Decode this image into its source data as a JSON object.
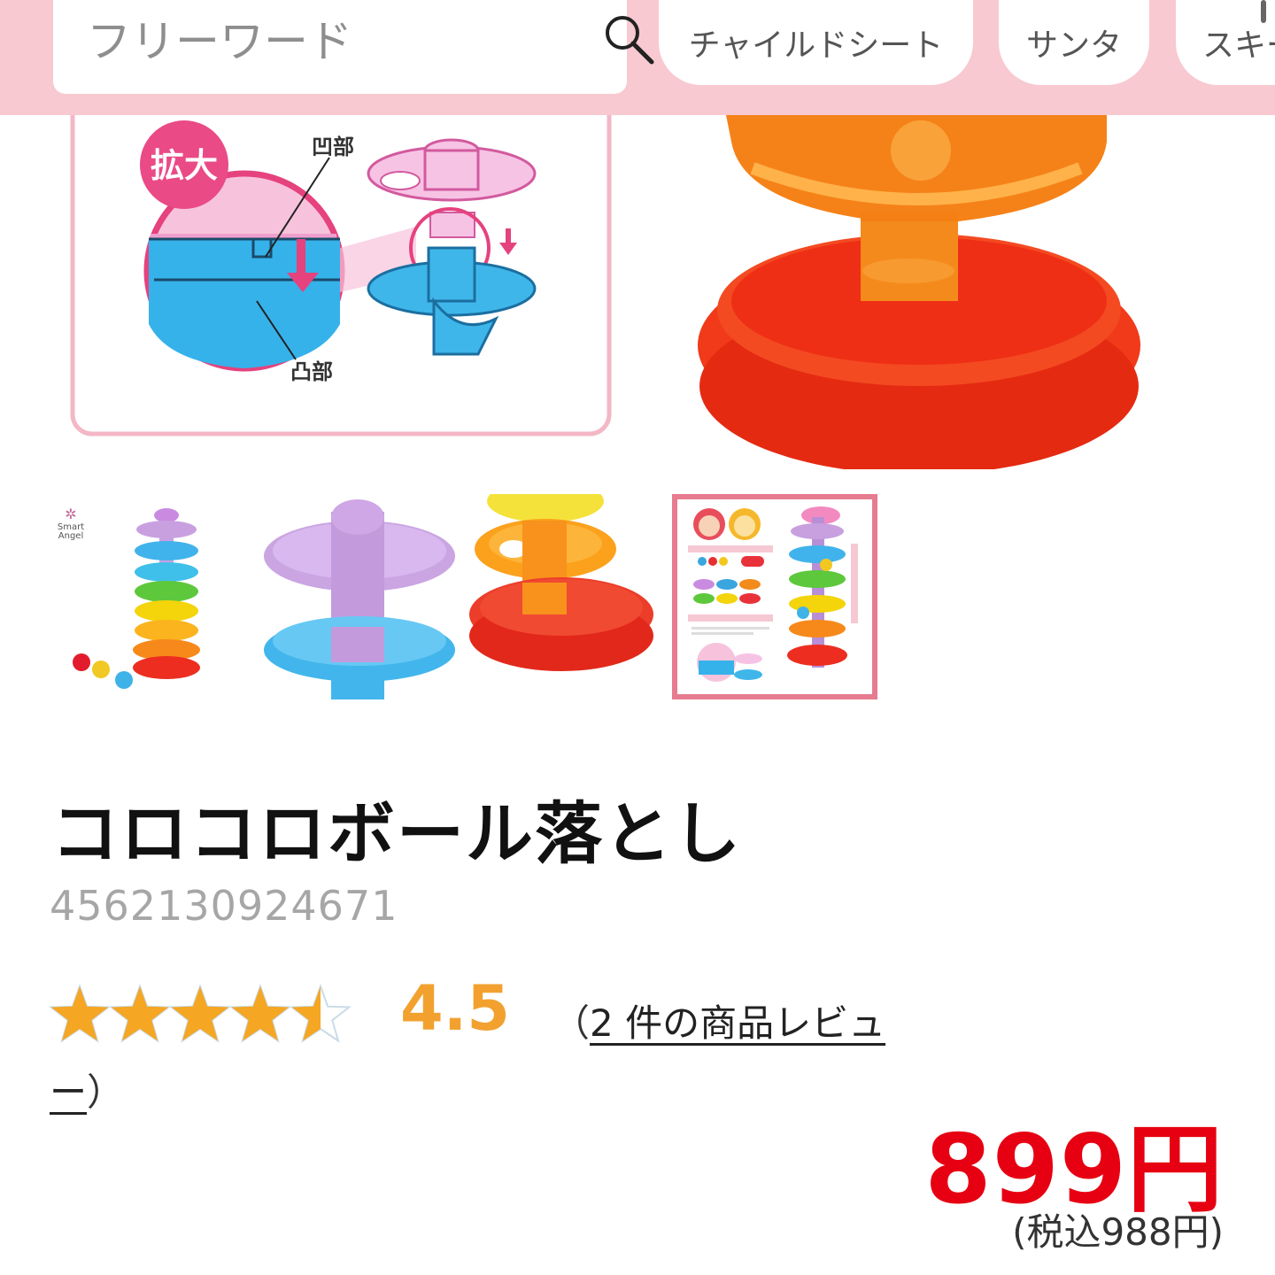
{
  "header": {
    "search": {
      "placeholder": "フリーワード"
    },
    "chips": [
      "チャイルドシート",
      "サンタ",
      "スキー"
    ]
  },
  "gallery": {
    "main_image": {
      "label_zoom": "拡大",
      "label_recess": "凹部",
      "label_protrusion": "凸部"
    },
    "thumb_1_brand": [
      "Smart",
      "Angel"
    ],
    "selected_thumb": 4
  },
  "product": {
    "title": "コロコロボール落とし",
    "jan": "4562130924671",
    "rating": "4.5",
    "rating_value": 4.5,
    "rating_max": 5,
    "review_open": "（",
    "review_link_1": "2 件の商品レビュ",
    "review_link_2": "ー",
    "review_close": "）",
    "price": "899円",
    "price_tax": "(税込988円)"
  },
  "colors": {
    "header_bg": "#f8c9d1",
    "price": "#e60012",
    "rating": "#f2a12f",
    "star": "#f5a623"
  }
}
